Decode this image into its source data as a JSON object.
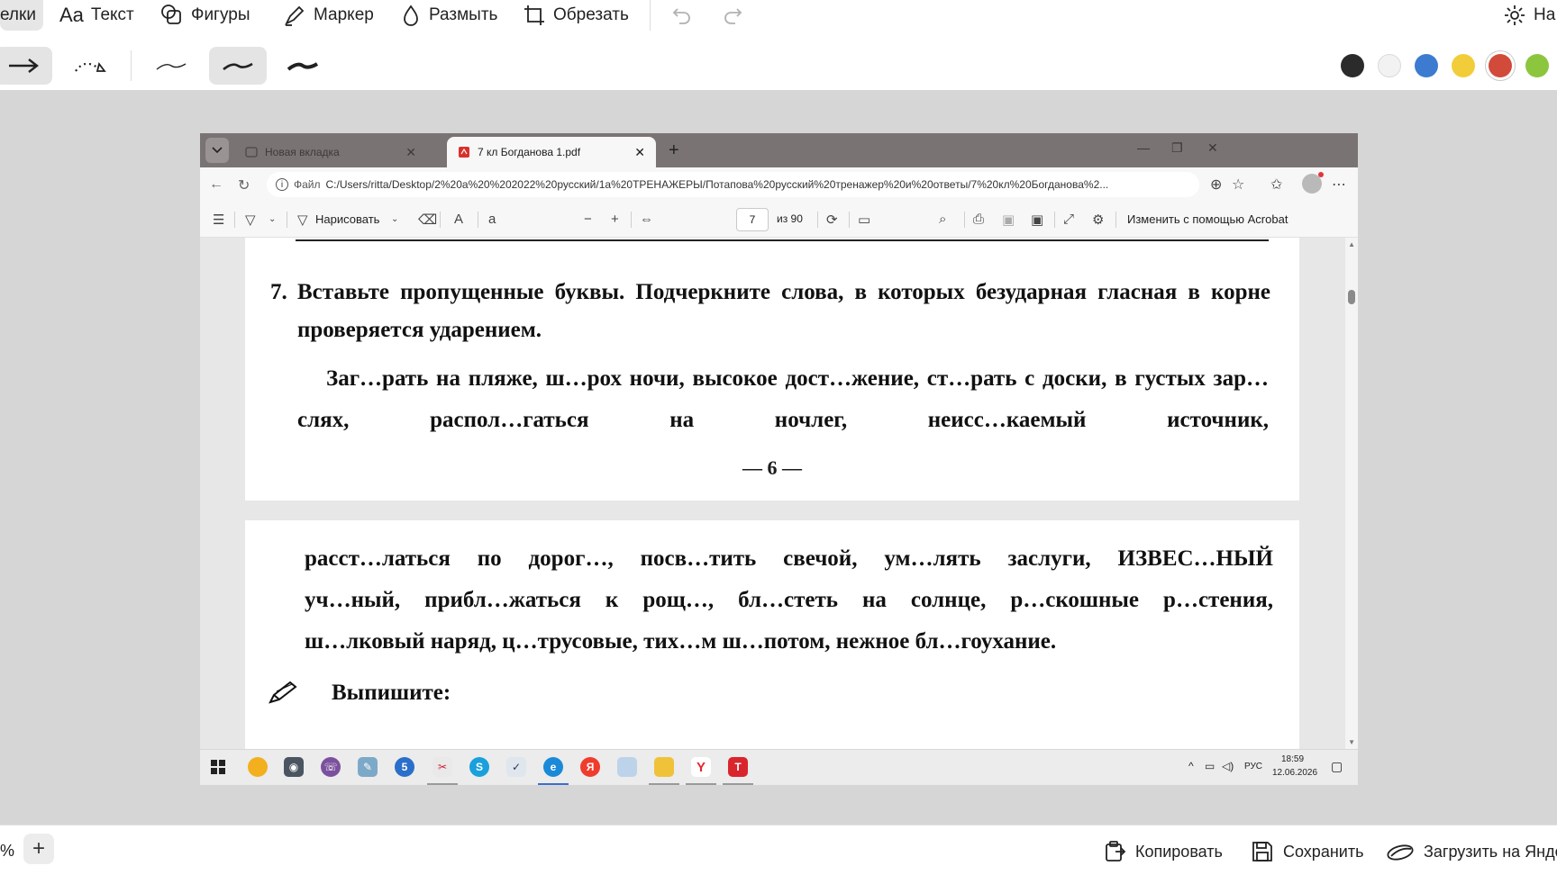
{
  "editor": {
    "tools": {
      "arrows_label": "елки",
      "text_label": "Текст",
      "text_icon": "Aa",
      "shapes_label": "Фигуры",
      "marker_label": "Маркер",
      "blur_label": "Размыть",
      "crop_label": "Обрезать",
      "settings_label": "На"
    },
    "colors": {
      "black": "#2b2b2b",
      "white": "#f2f2f2",
      "blue": "#3d7bd0",
      "yellow": "#f2cd3a",
      "red": "#d24a3a",
      "green": "#8cc63f",
      "selected": "red"
    },
    "bottom": {
      "zoom_fragment": "%",
      "copy_label": "Копировать",
      "save_label": "Сохранить",
      "upload_label": "Загрузить на Янде"
    }
  },
  "browser": {
    "tabs": [
      {
        "label": "Новая вкладка",
        "active": false
      },
      {
        "label": "7 кл Богданова 1.pdf",
        "active": true
      }
    ],
    "address": {
      "prefix": "Файл",
      "url": "C:/Users/ritta/Desktop/2%20a%20%202022%20русский/1a%20ТРЕНАЖЕРЫ/Потапова%20русский%20тренажер%20и%20ответы/7%20кл%20Богданова%2..."
    },
    "pdf_toolbar": {
      "draw_label": "Нарисовать",
      "page_current": "7",
      "page_total": "из 90",
      "acrobat_label": "Изменить с помощью Acrobat"
    }
  },
  "document": {
    "task_number": "7.",
    "task_text": "Вставьте пропущенные буквы. Подчеркните слова, в которых безударная гласная в корне проверяется ударением.",
    "paragraph_1": "Заг…рать на пляже, ш…рох ночи, высокое дост…жение,  ст…рать с доски, в густых зар…слях, распол…гаться на ночлег, неисс…каемый источник,",
    "page_number": "— 6 —",
    "paragraph_2_lines": [
      "расст…латься по дорог…, посв…тить свечой, ум…лять заслуги, ИЗВЕС…НЫЙ",
      "уч…ный, прибл…жаться к рощ…, бл…стеть на солнце, р…скошные р…стения,",
      "ш…лковый наряд, ц…трусовые, тих…м ш…потом, нежное бл…гоухание."
    ],
    "write_out_label": "Выпишите:"
  },
  "taskbar": {
    "lang": "РУС",
    "time": "18:59",
    "date": "12.06.2026"
  }
}
